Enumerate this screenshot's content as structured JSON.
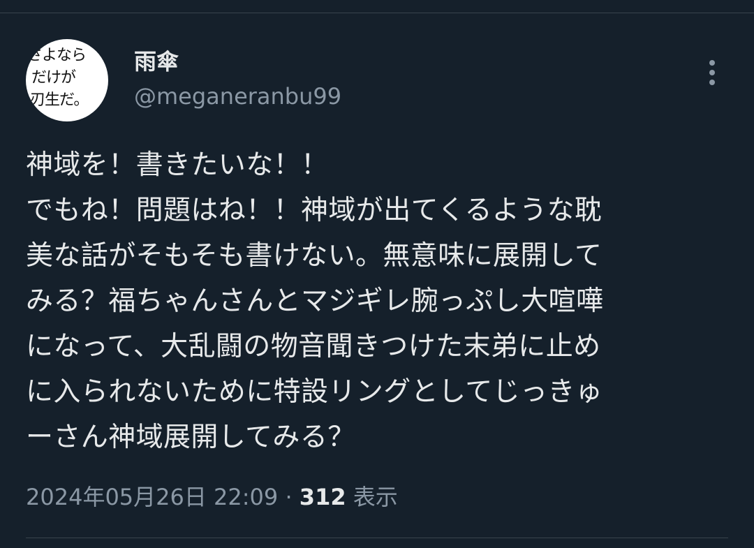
{
  "theme": {
    "background": "#15202b",
    "text_primary": "#e7e9ea",
    "text_secondary": "#8b98a5",
    "divider": "#38444d"
  },
  "author": {
    "avatar_lines": [
      "さよなら",
      "だけが",
      "刃生だ。"
    ],
    "display_name": "雨傘",
    "handle": "@meganeranbu99"
  },
  "more_icon": "more-vertical-icon",
  "tweet": {
    "lines": [
      "神域を！書きたいな！！",
      "でもね！問題はね！！神域が出てくるような耽",
      "美な話がそもそも書けない。無意味に展開して",
      "みる？福ちゃんさんとマジギレ腕っぷし大喧嘩",
      "になって、大乱闘の物音聞きつけた末弟に止め",
      "に入られないために特設リングとしてじっきゅ",
      "ーさん神域展開してみる？"
    ]
  },
  "meta": {
    "timestamp": "2024年05月26日 22:09",
    "separator": "·",
    "views_count": "312",
    "views_label": "表示"
  }
}
